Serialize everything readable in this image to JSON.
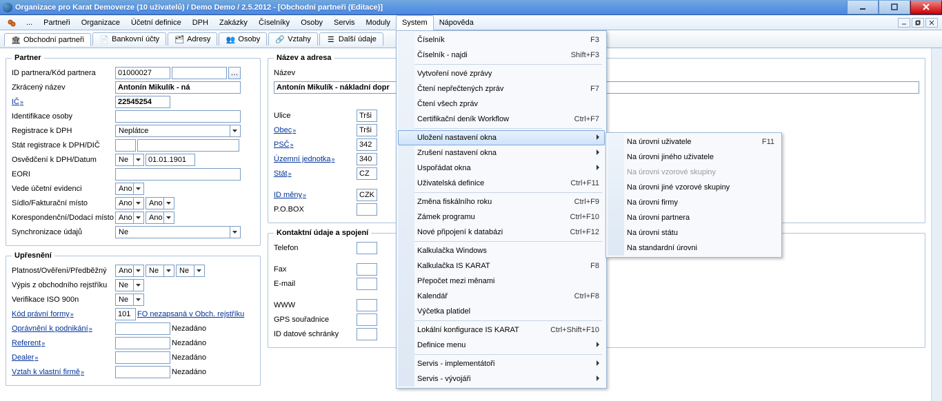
{
  "title": "Organizace pro Karat Demoverze (10 uživatelů) / Demo Demo / 2.5.2012 - [Obchodní partneři (Editace)]",
  "menubar": [
    "...",
    "Partneři",
    "Organizace",
    "Účetní definice",
    "DPH",
    "Zakázky",
    "Číselníky",
    "Osoby",
    "Servis",
    "Moduly",
    "System",
    "Nápověda"
  ],
  "tabs": [
    {
      "label": "Obchodní partneři"
    },
    {
      "label": "Bankovní účty"
    },
    {
      "label": "Adresy"
    },
    {
      "label": "Osoby"
    },
    {
      "label": "Vztahy"
    },
    {
      "label": "Další údaje"
    }
  ],
  "partner": {
    "legend": "Partner",
    "id_label": "ID partnera/Kód partnera",
    "id_val": "01000027",
    "zkr_label": "Zkrácený název",
    "zkr_val": "Antonín Mikulík - ná",
    "ic_label": "IČ",
    "ic_val": "22545254",
    "ident_label": "Identifikace osoby",
    "regdph_label": "Registrace k DPH",
    "regdph_val": "Neplátce",
    "statreg_label": "Stát registrace k DPH/DIČ",
    "osv_label": "Osvědčení k DPH/Datum",
    "osv_sel": "Ne",
    "osv_date": "01.01.1901",
    "eori_label": "EORI",
    "vede_label": "Vede účetní evidenci",
    "vede_val": "Ano",
    "sidlo_label": "Sídlo/Fakturační místo",
    "sidlo_a": "Ano",
    "sidlo_b": "Ano",
    "kores_label": "Korespondenční/Dodací místo",
    "kores_a": "Ano",
    "kores_b": "Ano",
    "sync_label": "Synchronizace údajů",
    "sync_val": "Ne"
  },
  "nazev": {
    "legend": "Název a adresa",
    "nazev_label": "Název",
    "nazev_val": "Antonín Mikulík - nákladní dopr",
    "ulice_label": "Ulice",
    "ulice_val": "Trši",
    "obec_label": "Obec",
    "obec_val": "Trši",
    "psc_label": "PSČ",
    "psc_val": "342",
    "uzemni_label": "Územní jednotka",
    "uzemni_val": "340",
    "stat_label": "Stát",
    "stat_val": "CZ",
    "idmeny_label": "ID měny",
    "idmeny_val": "CZK",
    "pobox_label": "P.O.BOX"
  },
  "upresneni": {
    "legend": "Upřesnění",
    "plat_label": "Platnost/Ověření/Předběžný",
    "plat_a": "Ano",
    "plat_b": "Ne",
    "plat_c": "Ne",
    "vypis_label": "Výpis z obchodního rejstříku",
    "vypis_val": "Ne",
    "verif_label": "Verifikace ISO 900n",
    "verif_val": "Ne",
    "kod_label": "Kód právní formy",
    "kod_val": "101",
    "kod_txt": "FO nezapsaná v Obch. rejstříku",
    "opravneni_label": "Oprávnění k podnikání",
    "nezadano": "Nezadáno",
    "referent_label": "Referent",
    "dealer_label": "Dealer",
    "vztah_label": "Vztah k vlastní firmě"
  },
  "kontakt": {
    "legend": "Kontaktní údaje a spojení",
    "telefon": "Telefon",
    "fax": "Fax",
    "email": "E-mail",
    "www": "WWW",
    "gps": "GPS souřadnice",
    "iddat": "ID datové schránky"
  },
  "sysmenu": [
    {
      "t": "Číselník",
      "s": "F3"
    },
    {
      "t": "Číselník - najdi",
      "s": "Shift+F3"
    },
    {
      "sep": true
    },
    {
      "t": "Vytvoření nové zprávy"
    },
    {
      "t": "Čtení nepřečtených zpráv",
      "s": "F7"
    },
    {
      "t": "Čtení všech zpráv"
    },
    {
      "t": "Certifikační deník Workflow",
      "s": "Ctrl+F7"
    },
    {
      "sep": true
    },
    {
      "t": "Uložení nastavení okna",
      "sub": true,
      "hover": true
    },
    {
      "t": "Zrušení nastavení okna",
      "sub": true
    },
    {
      "t": "Uspořádat okna",
      "sub": true
    },
    {
      "t": "Uživatelská definice",
      "s": "Ctrl+F11"
    },
    {
      "sep": true
    },
    {
      "t": "Změna fiskálního roku",
      "s": "Ctrl+F9"
    },
    {
      "t": "Zámek programu",
      "s": "Ctrl+F10"
    },
    {
      "t": "Nové připojení k databázi",
      "s": "Ctrl+F12"
    },
    {
      "sep": true
    },
    {
      "t": "Kalkulačka Windows"
    },
    {
      "t": "Kalkulačka IS KARAT",
      "s": "F8"
    },
    {
      "t": "Přepočet mezi měnami"
    },
    {
      "t": "Kalendář",
      "s": "Ctrl+F8"
    },
    {
      "t": "Výčetka platidel"
    },
    {
      "sep": true
    },
    {
      "t": "Lokální konfigurace IS KARAT",
      "s": "Ctrl+Shift+F10"
    },
    {
      "t": "Definice menu",
      "sub": true
    },
    {
      "sep": true
    },
    {
      "t": "Servis - implementátoři",
      "sub": true
    },
    {
      "t": "Servis - vývojáři",
      "sub": true
    }
  ],
  "submenu": [
    {
      "t": "Na úrovni uživatele",
      "s": "F11"
    },
    {
      "t": "Na úrovni jiného uživatele"
    },
    {
      "t": "Na úrovni vzorové skupiny",
      "disabled": true
    },
    {
      "t": "Na úrovni jiné vzorové skupiny"
    },
    {
      "t": "Na úrovni firmy"
    },
    {
      "t": "Na úrovni partnera"
    },
    {
      "t": "Na úrovni státu"
    },
    {
      "t": "Na standardní úrovni"
    }
  ]
}
